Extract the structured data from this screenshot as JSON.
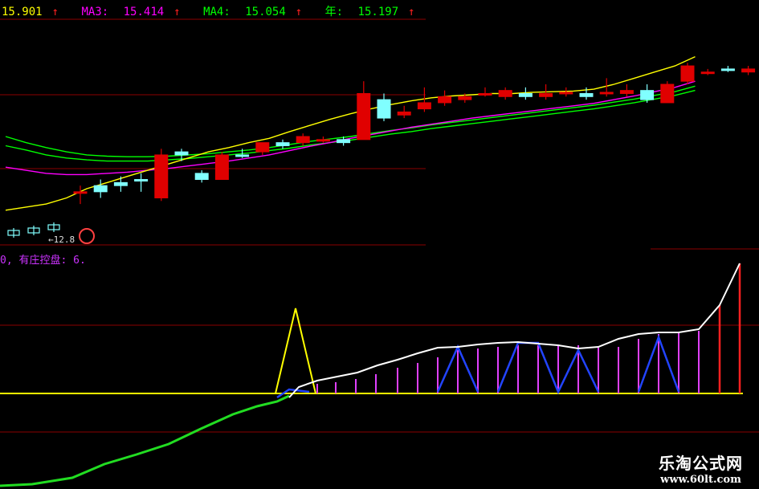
{
  "indicators": {
    "ma2": {
      "value": "15.901",
      "arrow": "↑"
    },
    "ma3": {
      "label": "MA3:",
      "value": "15.414",
      "arrow": "↑"
    },
    "ma4": {
      "label": "MA4:",
      "value": "15.054",
      "arrow": "↑"
    },
    "year": {
      "label": "年:",
      "value": "15.197",
      "arrow": "↑"
    }
  },
  "control": {
    "text": "0, 有庄控盘: 6."
  },
  "price_tag": {
    "text": "←12.8"
  },
  "watermark": {
    "name": "乐淘公式网",
    "url": "www.60lt.com"
  },
  "colors": {
    "up": "#e00000",
    "down": "#80ffff",
    "ma_yellow": "#ffff00",
    "ma_magenta": "#ff00ff",
    "ma_green": "#00ff00",
    "gridline": "#8b0000"
  },
  "chart_data": {
    "type": "candlestick",
    "candles": [
      {
        "o": 14.0,
        "h": 14.1,
        "l": 13.8,
        "c": 14.0,
        "color": "up"
      },
      {
        "o": 14.0,
        "h": 14.2,
        "l": 13.9,
        "c": 14.1,
        "color": "down"
      },
      {
        "o": 14.1,
        "h": 14.25,
        "l": 14.0,
        "c": 14.15,
        "color": "down"
      },
      {
        "o": 14.2,
        "h": 14.3,
        "l": 14.0,
        "c": 14.2,
        "color": "down"
      },
      {
        "o": 13.9,
        "h": 14.7,
        "l": 13.85,
        "c": 14.6,
        "color": "up"
      },
      {
        "o": 14.6,
        "h": 14.7,
        "l": 14.5,
        "c": 14.65,
        "color": "down"
      },
      {
        "o": 14.2,
        "h": 14.35,
        "l": 14.15,
        "c": 14.3,
        "color": "down"
      },
      {
        "o": 14.2,
        "h": 14.65,
        "l": 14.2,
        "c": 14.6,
        "color": "up"
      },
      {
        "o": 14.6,
        "h": 14.7,
        "l": 14.55,
        "c": 14.6,
        "color": "down"
      },
      {
        "o": 14.65,
        "h": 14.8,
        "l": 14.6,
        "c": 14.8,
        "color": "up"
      },
      {
        "o": 14.75,
        "h": 14.85,
        "l": 14.7,
        "c": 14.8,
        "color": "down"
      },
      {
        "o": 14.8,
        "h": 14.95,
        "l": 14.75,
        "c": 14.9,
        "color": "up"
      },
      {
        "o": 14.85,
        "h": 14.9,
        "l": 14.8,
        "c": 14.85,
        "color": "up"
      },
      {
        "o": 14.8,
        "h": 14.9,
        "l": 14.75,
        "c": 14.85,
        "color": "down"
      },
      {
        "o": 14.85,
        "h": 15.8,
        "l": 14.85,
        "c": 15.6,
        "color": "up"
      },
      {
        "o": 15.5,
        "h": 15.6,
        "l": 15.15,
        "c": 15.2,
        "color": "down"
      },
      {
        "o": 15.25,
        "h": 15.4,
        "l": 15.2,
        "c": 15.3,
        "color": "up"
      },
      {
        "o": 15.35,
        "h": 15.7,
        "l": 15.3,
        "c": 15.45,
        "color": "up"
      },
      {
        "o": 15.45,
        "h": 15.65,
        "l": 15.4,
        "c": 15.55,
        "color": "up"
      },
      {
        "o": 15.5,
        "h": 15.6,
        "l": 15.45,
        "c": 15.55,
        "color": "up"
      },
      {
        "o": 15.6,
        "h": 15.7,
        "l": 15.55,
        "c": 15.6,
        "color": "up"
      },
      {
        "o": 15.55,
        "h": 15.7,
        "l": 15.5,
        "c": 15.65,
        "color": "up"
      },
      {
        "o": 15.6,
        "h": 15.7,
        "l": 15.5,
        "c": 15.55,
        "color": "down"
      },
      {
        "o": 15.55,
        "h": 15.75,
        "l": 15.5,
        "c": 15.6,
        "color": "up"
      },
      {
        "o": 15.6,
        "h": 15.7,
        "l": 15.55,
        "c": 15.62,
        "color": "up"
      },
      {
        "o": 15.6,
        "h": 15.7,
        "l": 15.5,
        "c": 15.55,
        "color": "down"
      },
      {
        "o": 15.6,
        "h": 15.85,
        "l": 15.55,
        "c": 15.62,
        "color": "up"
      },
      {
        "o": 15.6,
        "h": 15.75,
        "l": 15.55,
        "c": 15.65,
        "color": "up"
      },
      {
        "o": 15.65,
        "h": 15.75,
        "l": 15.45,
        "c": 15.5,
        "color": "down"
      },
      {
        "o": 15.45,
        "h": 15.8,
        "l": 15.45,
        "c": 15.75,
        "color": "up"
      },
      {
        "o": 15.8,
        "h": 16.1,
        "l": 15.75,
        "c": 16.05,
        "color": "up"
      },
      {
        "o": 15.95,
        "h": 16.0,
        "l": 15.9,
        "c": 15.95,
        "color": "up"
      },
      {
        "o": 16.0,
        "h": 16.05,
        "l": 15.95,
        "c": 16.0,
        "color": "down"
      },
      {
        "o": 15.95,
        "h": 16.05,
        "l": 15.9,
        "c": 16.0,
        "color": "up"
      },
      {
        "o": 15.9,
        "h": 16.35,
        "l": 15.85,
        "c": 16.2,
        "color": "up"
      }
    ],
    "ma_yellow": [
      13.7,
      13.75,
      13.8,
      13.9,
      14.05,
      14.15,
      14.25,
      14.35,
      14.45,
      14.55,
      14.65,
      14.72,
      14.8,
      14.87,
      14.98,
      15.08,
      15.18,
      15.27,
      15.35,
      15.42,
      15.48,
      15.53,
      15.56,
      15.58,
      15.6,
      15.6,
      15.62,
      15.63,
      15.64,
      15.67,
      15.75,
      15.85,
      15.95,
      16.05,
      16.2
    ],
    "ma_magenta": [
      14.4,
      14.35,
      14.3,
      14.28,
      14.28,
      14.3,
      14.32,
      14.35,
      14.38,
      14.42,
      14.46,
      14.5,
      14.55,
      14.6,
      14.67,
      14.74,
      14.8,
      14.87,
      14.93,
      14.99,
      15.05,
      15.1,
      15.15,
      15.2,
      15.24,
      15.28,
      15.32,
      15.36,
      15.4,
      15.44,
      15.5,
      15.56,
      15.63,
      15.7,
      15.8
    ],
    "ma_green1": [
      14.9,
      14.8,
      14.72,
      14.65,
      14.6,
      14.58,
      14.57,
      14.57,
      14.58,
      14.6,
      14.62,
      14.65,
      14.68,
      14.72,
      14.77,
      14.82,
      14.86,
      14.9,
      14.95,
      15.0,
      15.04,
      15.09,
      15.13,
      15.17,
      15.21,
      15.25,
      15.29,
      15.33,
      15.37,
      15.41,
      15.46,
      15.51,
      15.57,
      15.63,
      15.72
    ],
    "ma_green2": [
      14.75,
      14.68,
      14.6,
      14.55,
      14.52,
      14.5,
      14.5,
      14.5,
      14.52,
      14.54,
      14.57,
      14.6,
      14.63,
      14.67,
      14.71,
      14.76,
      14.8,
      14.84,
      14.89,
      14.94,
      14.98,
      15.03,
      15.07,
      15.11,
      15.15,
      15.19,
      15.23,
      15.27,
      15.31,
      15.35,
      15.4,
      15.45,
      15.51,
      15.57,
      15.65
    ],
    "ylim": [
      13.2,
      16.6
    ],
    "sub_indicator": {
      "baseline": 0,
      "white_line": [
        -10,
        -9,
        -8,
        -7,
        -6,
        -5,
        -4,
        -3,
        -2,
        -1,
        0,
        2,
        4,
        6,
        8,
        10,
        16,
        21,
        24,
        27,
        34,
        37,
        41,
        45,
        47,
        47,
        47,
        47,
        47,
        47,
        47,
        47,
        47,
        47,
        47,
        47,
        47,
        47,
        47,
        47,
        47,
        47,
        47,
        47,
        44,
        42,
        43,
        45,
        47,
        49,
        52,
        54,
        56,
        56,
        58,
        60,
        62,
        78,
        100
      ],
      "green_line": [
        -140,
        -139,
        -136,
        -132,
        -126,
        -118,
        -110,
        -100,
        -90,
        -80,
        -70,
        -60,
        -50,
        -40,
        -30,
        -20,
        -15,
        -10,
        -5,
        -1,
        0
      ]
    }
  }
}
